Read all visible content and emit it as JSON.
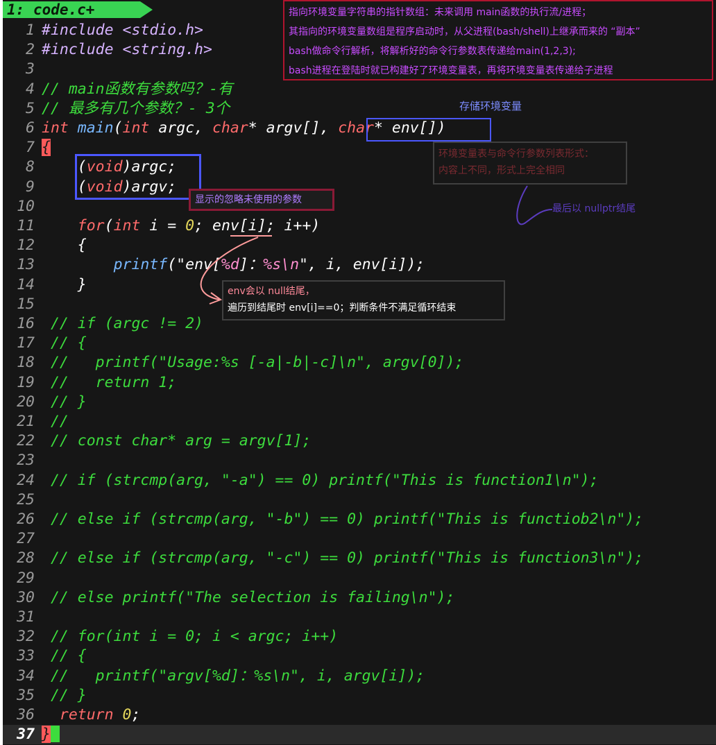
{
  "tab": {
    "label": "1: code.c+"
  },
  "annotations": {
    "env_explain": [
      "指向环境变量字符串的指针数组：未来调用 main函数的执行流/进程；",
      "其指向的环境变量数组是程序启动时，从父进程(bash/shell)上继承而来的 “副本”",
      "bash做命令行解析，将解析好的命令行参数表传递给main(1,2,3);",
      "bash进程在登陆时就已构建好了环境变量表，再将环境变量表传递给子进程"
    ],
    "store_env": "存储环境变量",
    "ignore_params": "显示的忽略未使用的参数",
    "format_note": [
      "环境变量表与命令行参数列表形式：",
      "内容上不同，形式上完全相同"
    ],
    "nullptr_end": "最后以 nullptr结尾",
    "null_end": [
      "env会以 null结尾，",
      "遍历到结尾时 env[i]==0；判断条件不满足循环结束"
    ]
  },
  "colors": {
    "background": "#161616",
    "tab": "#39d353",
    "comment": "#3ddc3d",
    "keyword": "#ff6b6b",
    "function": "#79b8ff",
    "number": "#e5d85c"
  },
  "lines": [
    {
      "n": "1",
      "segs": [
        [
          "#include <stdio.h>",
          "c-inc"
        ]
      ]
    },
    {
      "n": "2",
      "segs": [
        [
          "#include <string.h>",
          "c-inc"
        ]
      ]
    },
    {
      "n": "3",
      "segs": []
    },
    {
      "n": "4",
      "segs": [
        [
          "// main函数有参数吗？-有",
          "c-com"
        ]
      ]
    },
    {
      "n": "5",
      "segs": [
        [
          "// 最多有几个参数？- 3个",
          "c-com"
        ]
      ]
    },
    {
      "n": "6",
      "segs": [
        [
          "int",
          "c-type"
        ],
        [
          " ",
          "c-var"
        ],
        [
          "main",
          "c-fn"
        ],
        [
          "(",
          "c-var"
        ],
        [
          "int",
          "c-type"
        ],
        [
          " argc, ",
          "c-var"
        ],
        [
          "char",
          "c-type"
        ],
        [
          "* argv[], ",
          "c-var"
        ],
        [
          "char",
          "c-type"
        ],
        [
          "* env[])",
          "c-var"
        ]
      ]
    },
    {
      "n": "7",
      "segs": [
        [
          "{",
          "brace-hl"
        ]
      ]
    },
    {
      "n": "8",
      "segs": [
        [
          "    (",
          "c-var"
        ],
        [
          "void",
          "c-key"
        ],
        [
          ")argc;",
          "c-var"
        ]
      ]
    },
    {
      "n": "9",
      "segs": [
        [
          "    (",
          "c-var"
        ],
        [
          "void",
          "c-key"
        ],
        [
          ")argv;",
          "c-var"
        ]
      ]
    },
    {
      "n": "10",
      "segs": []
    },
    {
      "n": "11",
      "segs": [
        [
          "    ",
          "c-var"
        ],
        [
          "for",
          "c-key"
        ],
        [
          "(",
          "c-var"
        ],
        [
          "int",
          "c-type"
        ],
        [
          " i = ",
          "c-var"
        ],
        [
          "0",
          "c-num"
        ],
        [
          "; env[i]; i++)",
          "c-var"
        ]
      ]
    },
    {
      "n": "12",
      "segs": [
        [
          "    {",
          "c-var"
        ]
      ]
    },
    {
      "n": "13",
      "segs": [
        [
          "        ",
          "c-var"
        ],
        [
          "printf",
          "c-fn"
        ],
        [
          "(\"env[",
          "c-str"
        ],
        [
          "%d",
          "c-fmt"
        ],
        [
          "]：",
          "c-str"
        ],
        [
          "%s\\n",
          "c-fmt"
        ],
        [
          "\", i, env[i]);",
          "c-var"
        ]
      ]
    },
    {
      "n": "14",
      "segs": [
        [
          "    }",
          "c-var"
        ]
      ]
    },
    {
      "n": "15",
      "segs": []
    },
    {
      "n": "16",
      "segs": [
        [
          " // if (argc != 2)",
          "c-com"
        ]
      ]
    },
    {
      "n": "17",
      "segs": [
        [
          " // {",
          "c-com"
        ]
      ]
    },
    {
      "n": "18",
      "segs": [
        [
          " //   printf(\"Usage:%s [-a|-b|-c]\\n\", argv[0]);",
          "c-com"
        ]
      ]
    },
    {
      "n": "19",
      "segs": [
        [
          " //   return 1;",
          "c-com"
        ]
      ]
    },
    {
      "n": "20",
      "segs": [
        [
          " // }",
          "c-com"
        ]
      ]
    },
    {
      "n": "21",
      "segs": [
        [
          " //",
          "c-com"
        ]
      ]
    },
    {
      "n": "22",
      "segs": [
        [
          " // const char* arg = argv[1];",
          "c-com"
        ]
      ]
    },
    {
      "n": "23",
      "segs": []
    },
    {
      "n": "24",
      "segs": [
        [
          " // if (strcmp(arg, \"-a\") == 0) printf(\"This is function1\\n\");",
          "c-com"
        ]
      ]
    },
    {
      "n": "25",
      "segs": []
    },
    {
      "n": "26",
      "segs": [
        [
          " // else if (strcmp(arg, \"-b\") == 0) printf(\"This is functiob2\\n\");",
          "c-com"
        ]
      ]
    },
    {
      "n": "27",
      "segs": []
    },
    {
      "n": "28",
      "segs": [
        [
          " // else if (strcmp(arg, \"-c\") == 0) printf(\"This is function3\\n\");",
          "c-com"
        ]
      ]
    },
    {
      "n": "29",
      "segs": []
    },
    {
      "n": "30",
      "segs": [
        [
          " // else printf(\"The selection is failing\\n\");",
          "c-com"
        ]
      ]
    },
    {
      "n": "31",
      "segs": []
    },
    {
      "n": "32",
      "segs": [
        [
          " // for(int i = 0; i < argc; i++)",
          "c-com"
        ]
      ]
    },
    {
      "n": "33",
      "segs": [
        [
          " // {",
          "c-com"
        ]
      ]
    },
    {
      "n": "34",
      "segs": [
        [
          " //   printf(\"argv[%d]：%s\\n\", i, argv[i]);",
          "c-com"
        ]
      ]
    },
    {
      "n": "35",
      "segs": [
        [
          " // }",
          "c-com"
        ]
      ]
    },
    {
      "n": "36",
      "segs": [
        [
          "  ",
          "c-var"
        ],
        [
          "return",
          "c-key"
        ],
        [
          " ",
          "c-var"
        ],
        [
          "0",
          "c-num"
        ],
        [
          ";",
          "c-var"
        ]
      ]
    },
    {
      "n": "37",
      "segs": [
        [
          "}",
          "brace-hl"
        ]
      ],
      "current": true
    }
  ]
}
